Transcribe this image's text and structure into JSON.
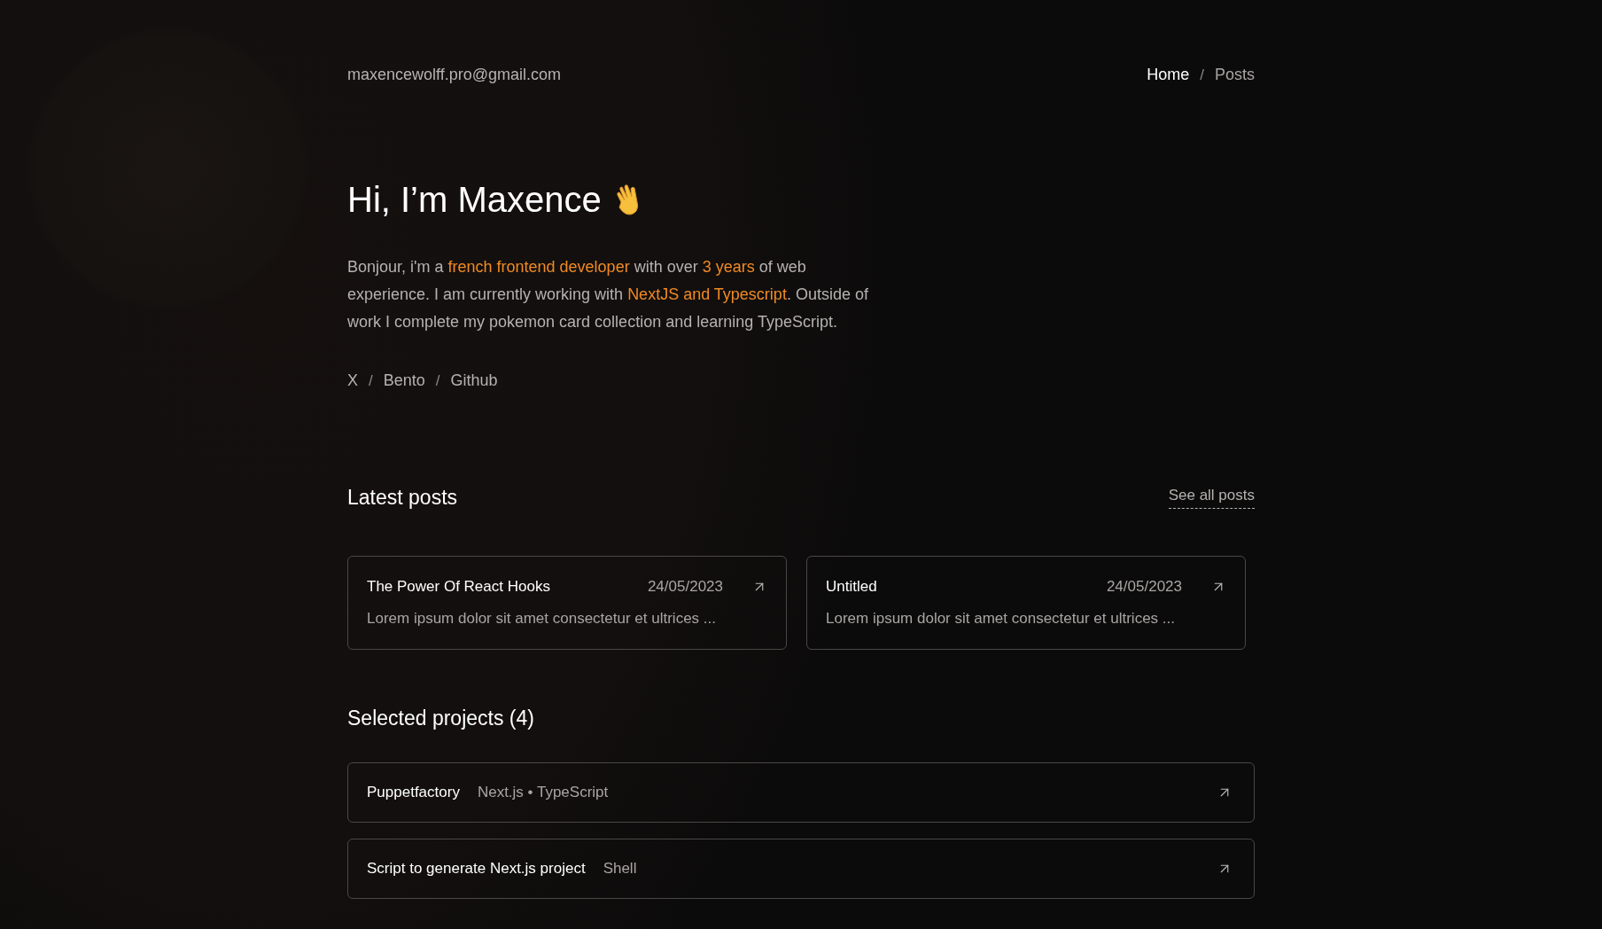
{
  "header": {
    "email": "maxencewolff.pro@gmail.com",
    "nav": [
      {
        "label": "Home",
        "selected": true
      },
      {
        "label": "Posts",
        "selected": false
      }
    ],
    "separator": "/"
  },
  "hero": {
    "title": "Hi, I’m Maxence",
    "bio": [
      {
        "text": "Bonjour, i'm a ",
        "highlighted": false
      },
      {
        "text": "french frontend developer",
        "highlighted": true
      },
      {
        "text": " with over ",
        "highlighted": false
      },
      {
        "text": "3 years",
        "highlighted": true
      },
      {
        "text": " of web experience. I am currently working with ",
        "highlighted": false
      },
      {
        "text": "NextJS and Typescript",
        "highlighted": true
      },
      {
        "text": ". Outside of work I complete my pokemon card collection and learning TypeScript.",
        "highlighted": false
      }
    ],
    "socials": [
      "X",
      "Bento",
      "Github"
    ],
    "separator": "/"
  },
  "latest_posts": {
    "title": "Latest posts",
    "see_all": "See all posts",
    "posts": [
      {
        "title": "The Power Of React Hooks",
        "date": "24/05/2023",
        "excerpt": "Lorem ipsum dolor sit amet consectetur et ultrices ..."
      },
      {
        "title": "Untitled",
        "date": "24/05/2023",
        "excerpt": "Lorem ipsum dolor sit amet consectetur et ultrices ..."
      }
    ]
  },
  "projects": {
    "title": "Selected projects (4)",
    "items": [
      {
        "name": "Puppetfactory",
        "stack": "Next.js • TypeScript"
      },
      {
        "name": "Script to generate Next.js project",
        "stack": "Shell"
      }
    ]
  }
}
